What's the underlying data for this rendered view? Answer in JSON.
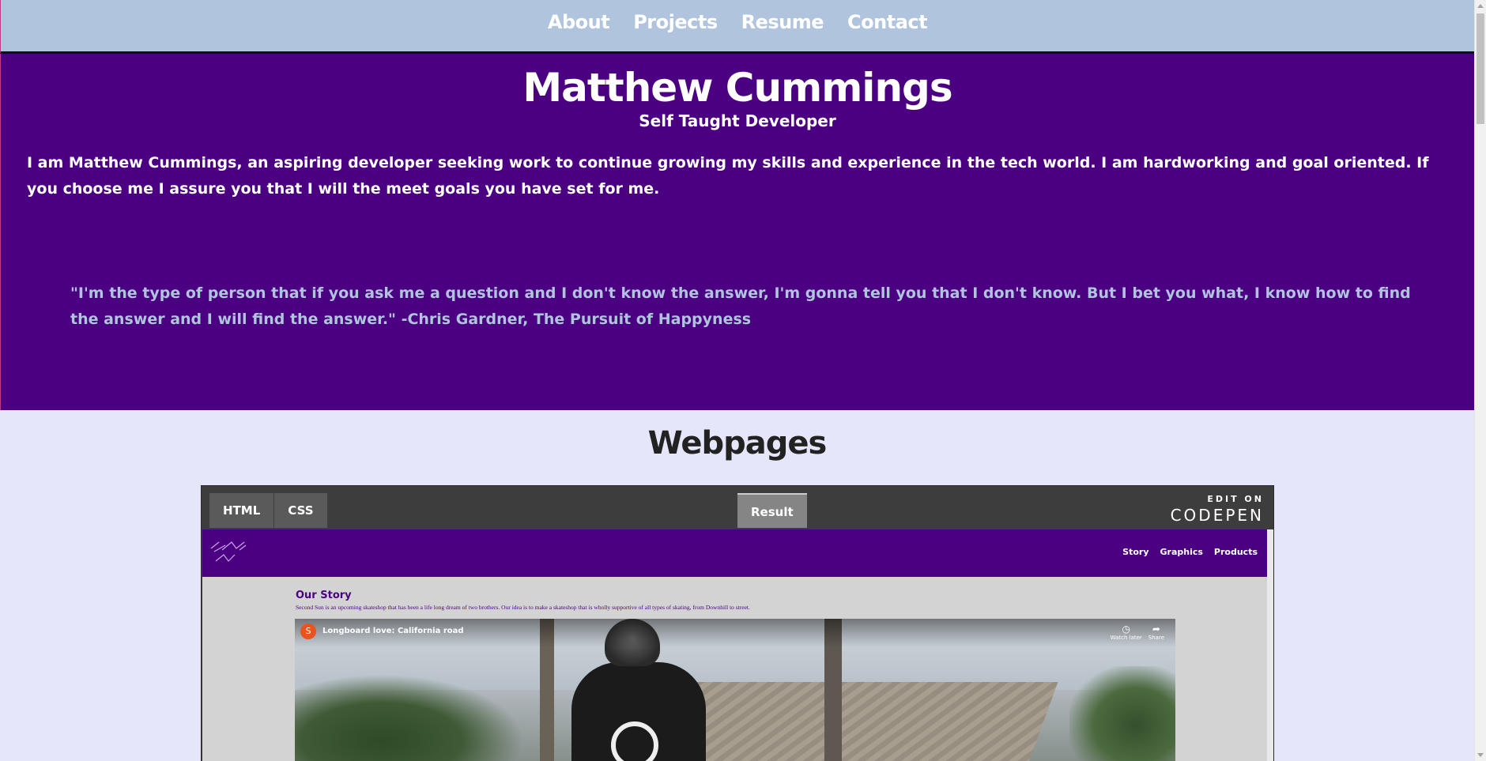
{
  "nav": {
    "links": [
      "About",
      "Projects",
      "Resume",
      "Contact"
    ]
  },
  "hero": {
    "name": "Matthew Cummings",
    "subtitle": "Self Taught Developer",
    "intro": "I am Matthew Cummings, an aspiring developer seeking work to continue growing my skills and experience in the tech world. I am hardworking and goal oriented. If you choose me I assure you that I will the meet goals you have set for me.",
    "quote": "\"I'm the type of person that if you ask me a question and I don't know the answer, I'm gonna tell you that I don't know. But I bet you what, I know how to find the answer and I will find the answer.\" -Chris Gardner, The Pursuit of Happyness"
  },
  "webpages": {
    "title": "Webpages",
    "codepen": {
      "tabs": [
        "HTML",
        "CSS"
      ],
      "result_label": "Result",
      "edit_on": "EDIT ON",
      "brand": "CODEPEN",
      "embed": {
        "nav_links": [
          "Story",
          "Graphics",
          "Products"
        ],
        "story_title": "Our Story",
        "story_text": "Second Sun is an upcoming skateshop that has been a life long dream of two brothers. Our idea is to make a skateshop that is wholly supportive of all types of skating, from Downhill to street.",
        "video": {
          "channel_initial": "S",
          "title": "Longboard love: California road",
          "watch_later": "Watch later",
          "share": "Share"
        }
      }
    }
  },
  "colors": {
    "nav_bg": "#b0c4de",
    "hero_bg": "#4b0082",
    "page_bg": "#e6e6fa",
    "quote_text": "#b0c4de"
  }
}
